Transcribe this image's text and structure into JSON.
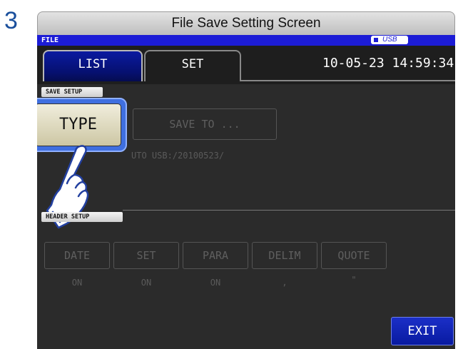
{
  "step_number": "3",
  "window_title": "File Save Setting Screen",
  "status_bar": {
    "mode_label": "FILE",
    "storage_indicator": "USB"
  },
  "tabs": [
    {
      "label": "LIST"
    },
    {
      "label": "SET"
    }
  ],
  "datetime": "10-05-23 14:59:34",
  "save_setup": {
    "section_label": "SAVE SETUP",
    "type_button": "TYPE",
    "save_to_button": "SAVE TO ...",
    "save_info": "UTO  USB:/20100523/"
  },
  "header_setup": {
    "section_label": "HEADER SETUP",
    "buttons": [
      {
        "label": "DATE",
        "value": "ON"
      },
      {
        "label": "SET",
        "value": "ON"
      },
      {
        "label": "PARA",
        "value": "ON"
      },
      {
        "label": "DELIM",
        "value": ","
      },
      {
        "label": "QUOTE",
        "value": "\""
      }
    ]
  },
  "exit_button": "EXIT",
  "colors": {
    "accent_blue": "#1c1cd6",
    "selected_tab": "#061070",
    "highlight": "#3f6fe0"
  },
  "icons": {
    "pointer": "pointing-hand-icon"
  }
}
